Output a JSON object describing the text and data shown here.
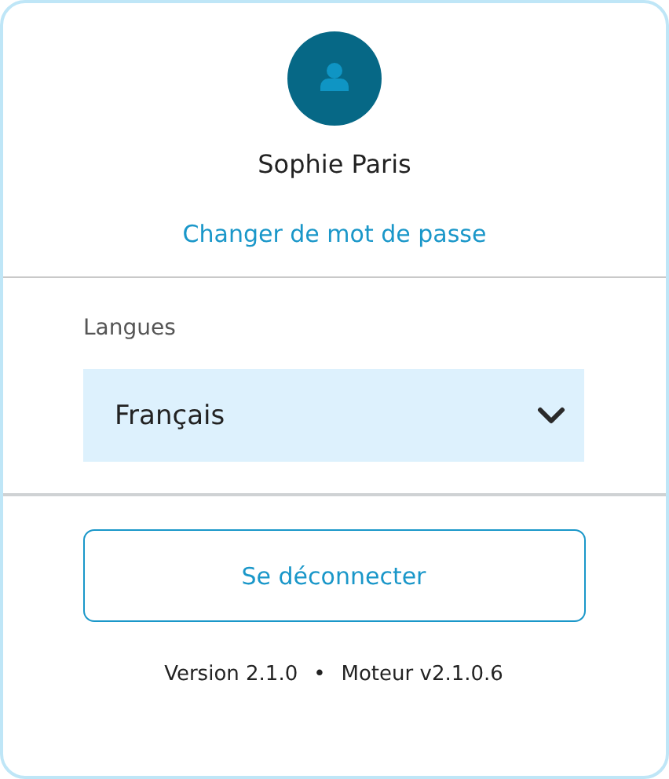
{
  "profile": {
    "name": "Sophie Paris",
    "change_password_link": "Changer de mot de passe"
  },
  "language": {
    "label": "Langues",
    "value": "Français"
  },
  "logout_button": "Se déconnecter",
  "footer": {
    "version": "Version 2.1.0",
    "separator": "•",
    "engine": "Moteur v2.1.0.6"
  }
}
